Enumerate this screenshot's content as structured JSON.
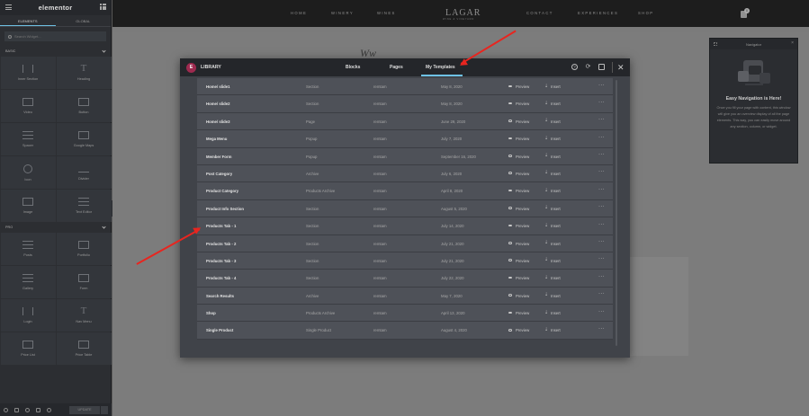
{
  "panel": {
    "logo": "elementor",
    "tabs": [
      {
        "label": "ELEMENTS"
      },
      {
        "label": "GLOBAL"
      }
    ],
    "search_placeholder": "Search Widget...",
    "categories": [
      {
        "label": "BASIC"
      },
      {
        "label": "PRO"
      }
    ],
    "basic_widgets": [
      {
        "label": "Inner Section",
        "icon": "columns-icon"
      },
      {
        "label": "Heading",
        "icon": "heading-icon"
      },
      {
        "label": "Video",
        "icon": "video-icon"
      },
      {
        "label": "Button",
        "icon": "button-icon"
      },
      {
        "label": "Spacer",
        "icon": "spacer-icon"
      },
      {
        "label": "Google Maps",
        "icon": "map-icon"
      },
      {
        "label": "Icon",
        "icon": "star-icon"
      },
      {
        "label": "Divider",
        "icon": "divider-icon"
      },
      {
        "label": "Image",
        "icon": "image-icon"
      },
      {
        "label": "Text Editor",
        "icon": "text-editor-icon"
      }
    ],
    "pro_widgets": [
      {
        "label": "Posts",
        "icon": "posts-icon"
      },
      {
        "label": "Portfolio",
        "icon": "portfolio-icon"
      },
      {
        "label": "Gallery",
        "icon": "gallery-icon"
      },
      {
        "label": "Form",
        "icon": "form-icon"
      },
      {
        "label": "Login",
        "icon": "login-icon"
      },
      {
        "label": "Nav Menu",
        "icon": "nav-menu-icon"
      },
      {
        "label": "Price List",
        "icon": "price-list-icon"
      },
      {
        "label": "Price Table",
        "icon": "price-table-icon"
      }
    ],
    "update_label": "UPDATE"
  },
  "site": {
    "nav_links": [
      {
        "label": "HOME"
      },
      {
        "label": "WINERY"
      },
      {
        "label": "WINES"
      },
      {
        "label": "CONTACT"
      },
      {
        "label": "EXPERIENCES"
      },
      {
        "label": "SHOP"
      }
    ],
    "brand": "LAGAR",
    "brand_sub": "WINE & VINEYARD",
    "cart_count": "0",
    "signature": "Ww"
  },
  "navigator": {
    "title": "Navigator",
    "empty_title": "Easy Navigation is Here!",
    "empty_text": "Once you fill your page with content, this window will give you an overview display of all the page elements. This way, you can easily move around any section, column, or widget."
  },
  "library": {
    "title": "LIBRARY",
    "logo": "E",
    "tabs": [
      {
        "label": "Blocks"
      },
      {
        "label": "Pages"
      },
      {
        "label": "My Templates",
        "active": true
      }
    ],
    "preview_label": "Preview",
    "insert_label": "Insert",
    "templates": [
      {
        "name": "Home/ slide1",
        "type": "Section",
        "author": "remtam",
        "date": "May 8, 2020"
      },
      {
        "name": "Home/ slide2",
        "type": "Section",
        "author": "remtam",
        "date": "May 8, 2020"
      },
      {
        "name": "Home/ slide3",
        "type": "Page",
        "author": "remtam",
        "date": "June 29, 2020"
      },
      {
        "name": "Mega Menu",
        "type": "Popup",
        "author": "remtam",
        "date": "July 7, 2020"
      },
      {
        "name": "Member Form",
        "type": "Popup",
        "author": "remtam",
        "date": "September 16, 2020"
      },
      {
        "name": "Post Category",
        "type": "Archive",
        "author": "remtam",
        "date": "July 6, 2020"
      },
      {
        "name": "Product Category",
        "type": "Products Archive",
        "author": "remtam",
        "date": "April 8, 2020"
      },
      {
        "name": "Product Info Section",
        "type": "Section",
        "author": "remtam",
        "date": "August 5, 2020"
      },
      {
        "name": "Products Tab - 1",
        "type": "Section",
        "author": "remtam",
        "date": "July 14, 2020"
      },
      {
        "name": "Products Tab - 2",
        "type": "Section",
        "author": "remtam",
        "date": "July 21, 2020"
      },
      {
        "name": "Products Tab - 3",
        "type": "Section",
        "author": "remtam",
        "date": "July 21, 2020"
      },
      {
        "name": "Products Tab - 4",
        "type": "Section",
        "author": "remtam",
        "date": "July 22, 2020"
      },
      {
        "name": "Search Results",
        "type": "Archive",
        "author": "remtam",
        "date": "May 7, 2020"
      },
      {
        "name": "Shop",
        "type": "Products Archive",
        "author": "remtam",
        "date": "April 13, 2020"
      },
      {
        "name": "Single Product",
        "type": "Single Product",
        "author": "remtam",
        "date": "August 4, 2020"
      }
    ]
  },
  "colors": {
    "accent": "#6ec1e4",
    "annotation": "#e8251f",
    "elementor_brand": "#9e2a4f"
  }
}
